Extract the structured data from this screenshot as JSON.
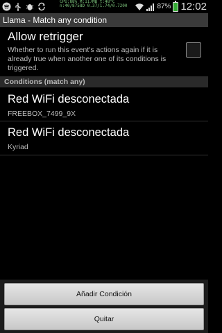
{
  "status_bar": {
    "overlay_lines": [
      "CPU:88% M:117MB t:48°C",
      "n:40/8758D 0.37/1.74/0.7200"
    ],
    "battery_pct": "87%",
    "clock": "12:02",
    "left_icons": [
      "spotify-icon",
      "usb-icon",
      "bug-icon",
      "sync-icon"
    ]
  },
  "title_bar": {
    "title": "Llama - Match any condition"
  },
  "retrigger": {
    "title": "Allow retrigger",
    "description": "Whether to run this event's actions again if it is already true when another one of its conditions is triggered.",
    "checked": false
  },
  "conditions_header": "Conditions (match any)",
  "conditions": [
    {
      "title": "Red WiFi desconectada",
      "subtitle": "FREEBOX_7499_9X"
    },
    {
      "title": "Red WiFi desconectada",
      "subtitle": "Kyriad"
    }
  ],
  "buttons": {
    "add": "Añadir Condición",
    "remove": "Quitar"
  }
}
